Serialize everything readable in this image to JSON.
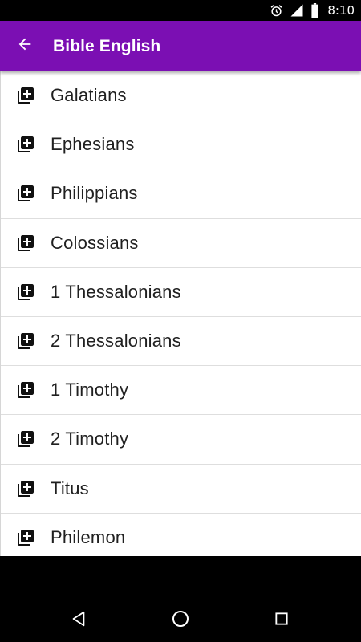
{
  "status_bar": {
    "time": "8:10",
    "icons": [
      "alarm-icon",
      "signal-icon",
      "battery-icon"
    ]
  },
  "app_bar": {
    "title": "Bible English",
    "back_icon": "arrow-back-icon",
    "color": "#7b0fb3"
  },
  "books": [
    {
      "label": "Galatians",
      "icon": "library-add-icon"
    },
    {
      "label": "Ephesians",
      "icon": "library-add-icon"
    },
    {
      "label": "Philippians",
      "icon": "library-add-icon"
    },
    {
      "label": "Colossians",
      "icon": "library-add-icon"
    },
    {
      "label": "1 Thessalonians",
      "icon": "library-add-icon"
    },
    {
      "label": "2 Thessalonians",
      "icon": "library-add-icon"
    },
    {
      "label": "1 Timothy",
      "icon": "library-add-icon"
    },
    {
      "label": "2 Timothy",
      "icon": "library-add-icon"
    },
    {
      "label": "Titus",
      "icon": "library-add-icon"
    },
    {
      "label": "Philemon",
      "icon": "library-add-icon"
    }
  ],
  "nav_bar": {
    "icons": [
      "back-triangle-icon",
      "home-circle-icon",
      "recents-square-icon"
    ]
  }
}
